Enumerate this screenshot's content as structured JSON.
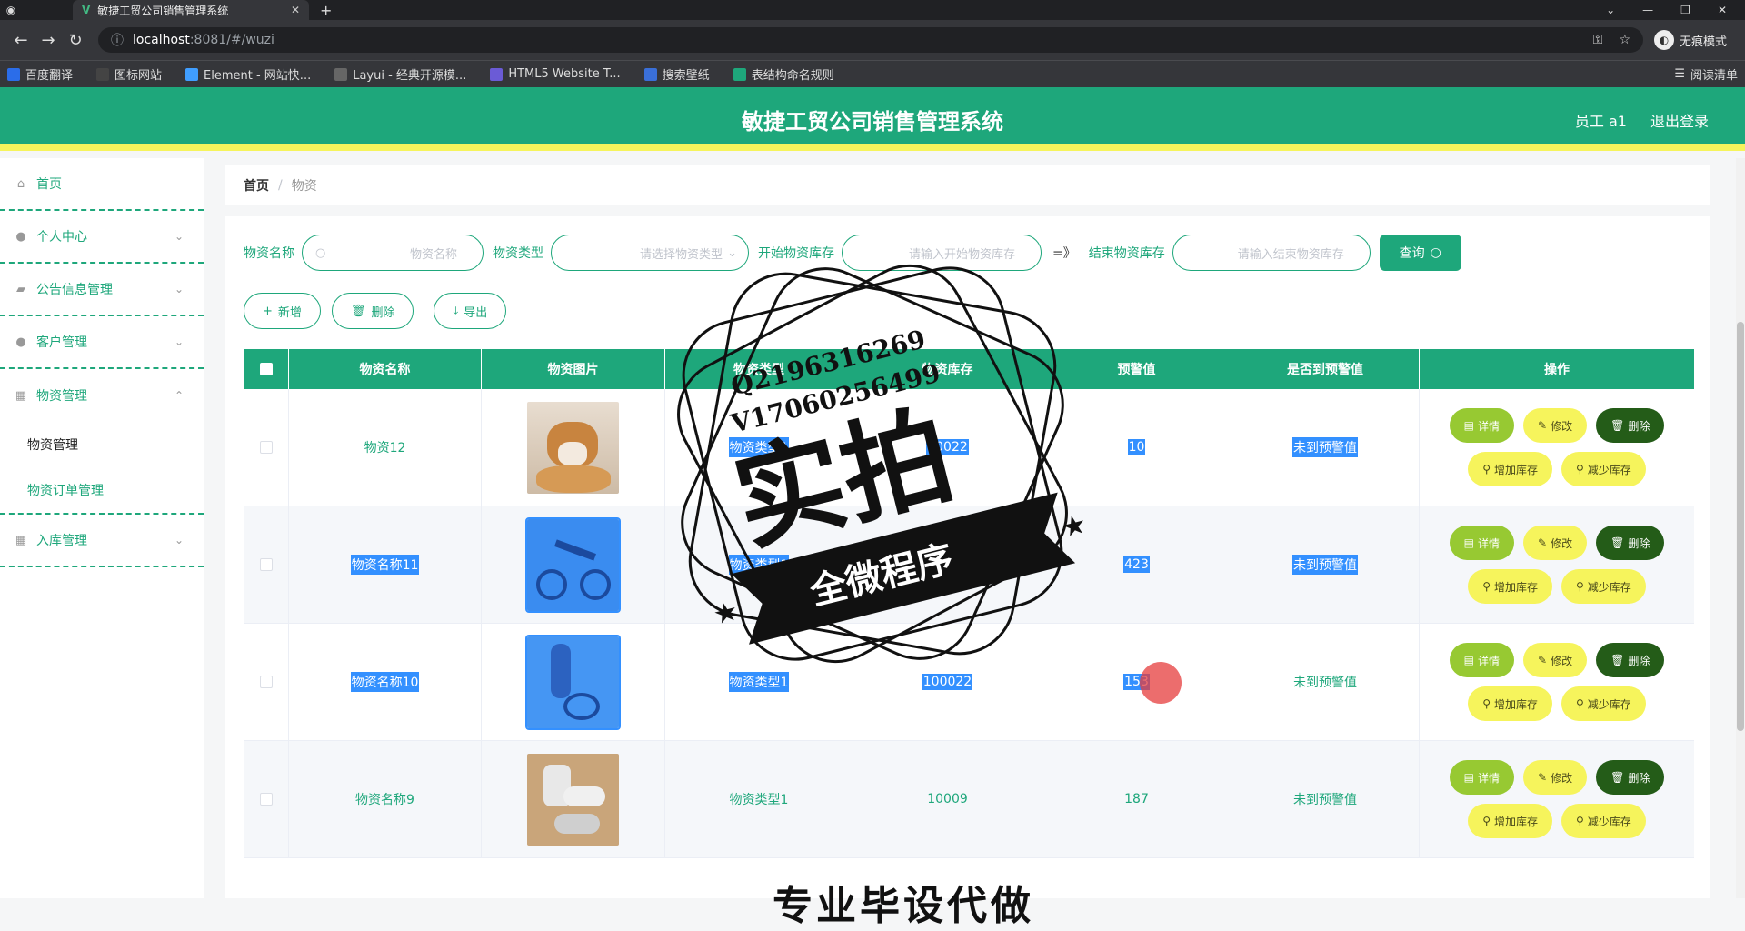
{
  "browser": {
    "tab_title": "敏捷工贸公司销售管理系统",
    "tab_close": "✕",
    "new_tab": "+",
    "url_host": "localhost",
    "url_path": ":8081/#/wuzi",
    "incognito_label": "无痕模式",
    "bookmarks": [
      {
        "label": "百度翻译",
        "color": "#2b6de9"
      },
      {
        "label": "图标网站",
        "color": "#444"
      },
      {
        "label": "Element - 网站快...",
        "color": "#409eff"
      },
      {
        "label": "Layui - 经典开源模...",
        "color": "#666"
      },
      {
        "label": "HTML5 Website T...",
        "color": "#6b5bd6"
      },
      {
        "label": "搜索壁纸",
        "color": "#3a6fd8"
      },
      {
        "label": "表结构命名规则",
        "color": "#1ea77b"
      }
    ],
    "reading_list": "阅读清单"
  },
  "header": {
    "title": "敏捷工贸公司销售管理系统",
    "user": "员工 a1",
    "logout": "退出登录"
  },
  "sidebar": {
    "items": [
      {
        "label": "首页",
        "icon": "home-icon",
        "glyph": "⌂"
      },
      {
        "label": "个人中心",
        "icon": "user-icon",
        "glyph": "●"
      },
      {
        "label": "公告信息管理",
        "icon": "notice-icon",
        "glyph": "▰"
      },
      {
        "label": "客户管理",
        "icon": "user-icon",
        "glyph": "●"
      },
      {
        "label": "物资管理",
        "icon": "grid-icon",
        "glyph": "▦"
      },
      {
        "label": "入库管理",
        "icon": "grid-icon",
        "glyph": "▦"
      }
    ],
    "subitems": [
      "物资管理",
      "物资订单管理"
    ]
  },
  "breadcrumb": {
    "home": "首页",
    "sep": "/",
    "current": "物资"
  },
  "search": {
    "name_label": "物资名称",
    "name_placeholder": "物资名称",
    "type_label": "物资类型",
    "type_placeholder": "请选择物资类型",
    "start_label": "开始物资库存",
    "start_placeholder": "请输入开始物资库存",
    "arrow": "=》",
    "end_label": "结束物资库存",
    "end_placeholder": "请输入结束物资库存",
    "query": "查询"
  },
  "actions": {
    "add": "新增",
    "delete": "删除",
    "export": "导出"
  },
  "table": {
    "headers": [
      "物资名称",
      "物资图片",
      "物资类型",
      "物资库存",
      "预警值",
      "是否到预警值",
      "操作"
    ],
    "rows": [
      {
        "name": "物资12",
        "type": "物资类型1",
        "stock": "10022",
        "warn": "10",
        "reached": "未到预警值",
        "image": "dog"
      },
      {
        "name": "物资名称11",
        "type": "物资类型1",
        "stock": "10022",
        "warn": "423",
        "reached": "未到预警值",
        "image": "bike"
      },
      {
        "name": "物资名称10",
        "type": "物资类型1",
        "stock": "100022",
        "warn": "153",
        "reached": "未到预警值",
        "image": "bike2"
      },
      {
        "name": "物资名称9",
        "type": "物资类型1",
        "stock": "10009",
        "warn": "187",
        "reached": "未到预警值",
        "image": "tags"
      }
    ],
    "ops": {
      "detail": "详情",
      "edit": "修改",
      "del": "删除",
      "add_stock": "增加库存",
      "sub_stock": "减少库存"
    }
  },
  "watermark": {
    "q": "Q2196316269",
    "v": "V17060256499",
    "big": "实拍",
    "banner": "全微程序"
  },
  "bottom_overlay": "专业毕设代做"
}
